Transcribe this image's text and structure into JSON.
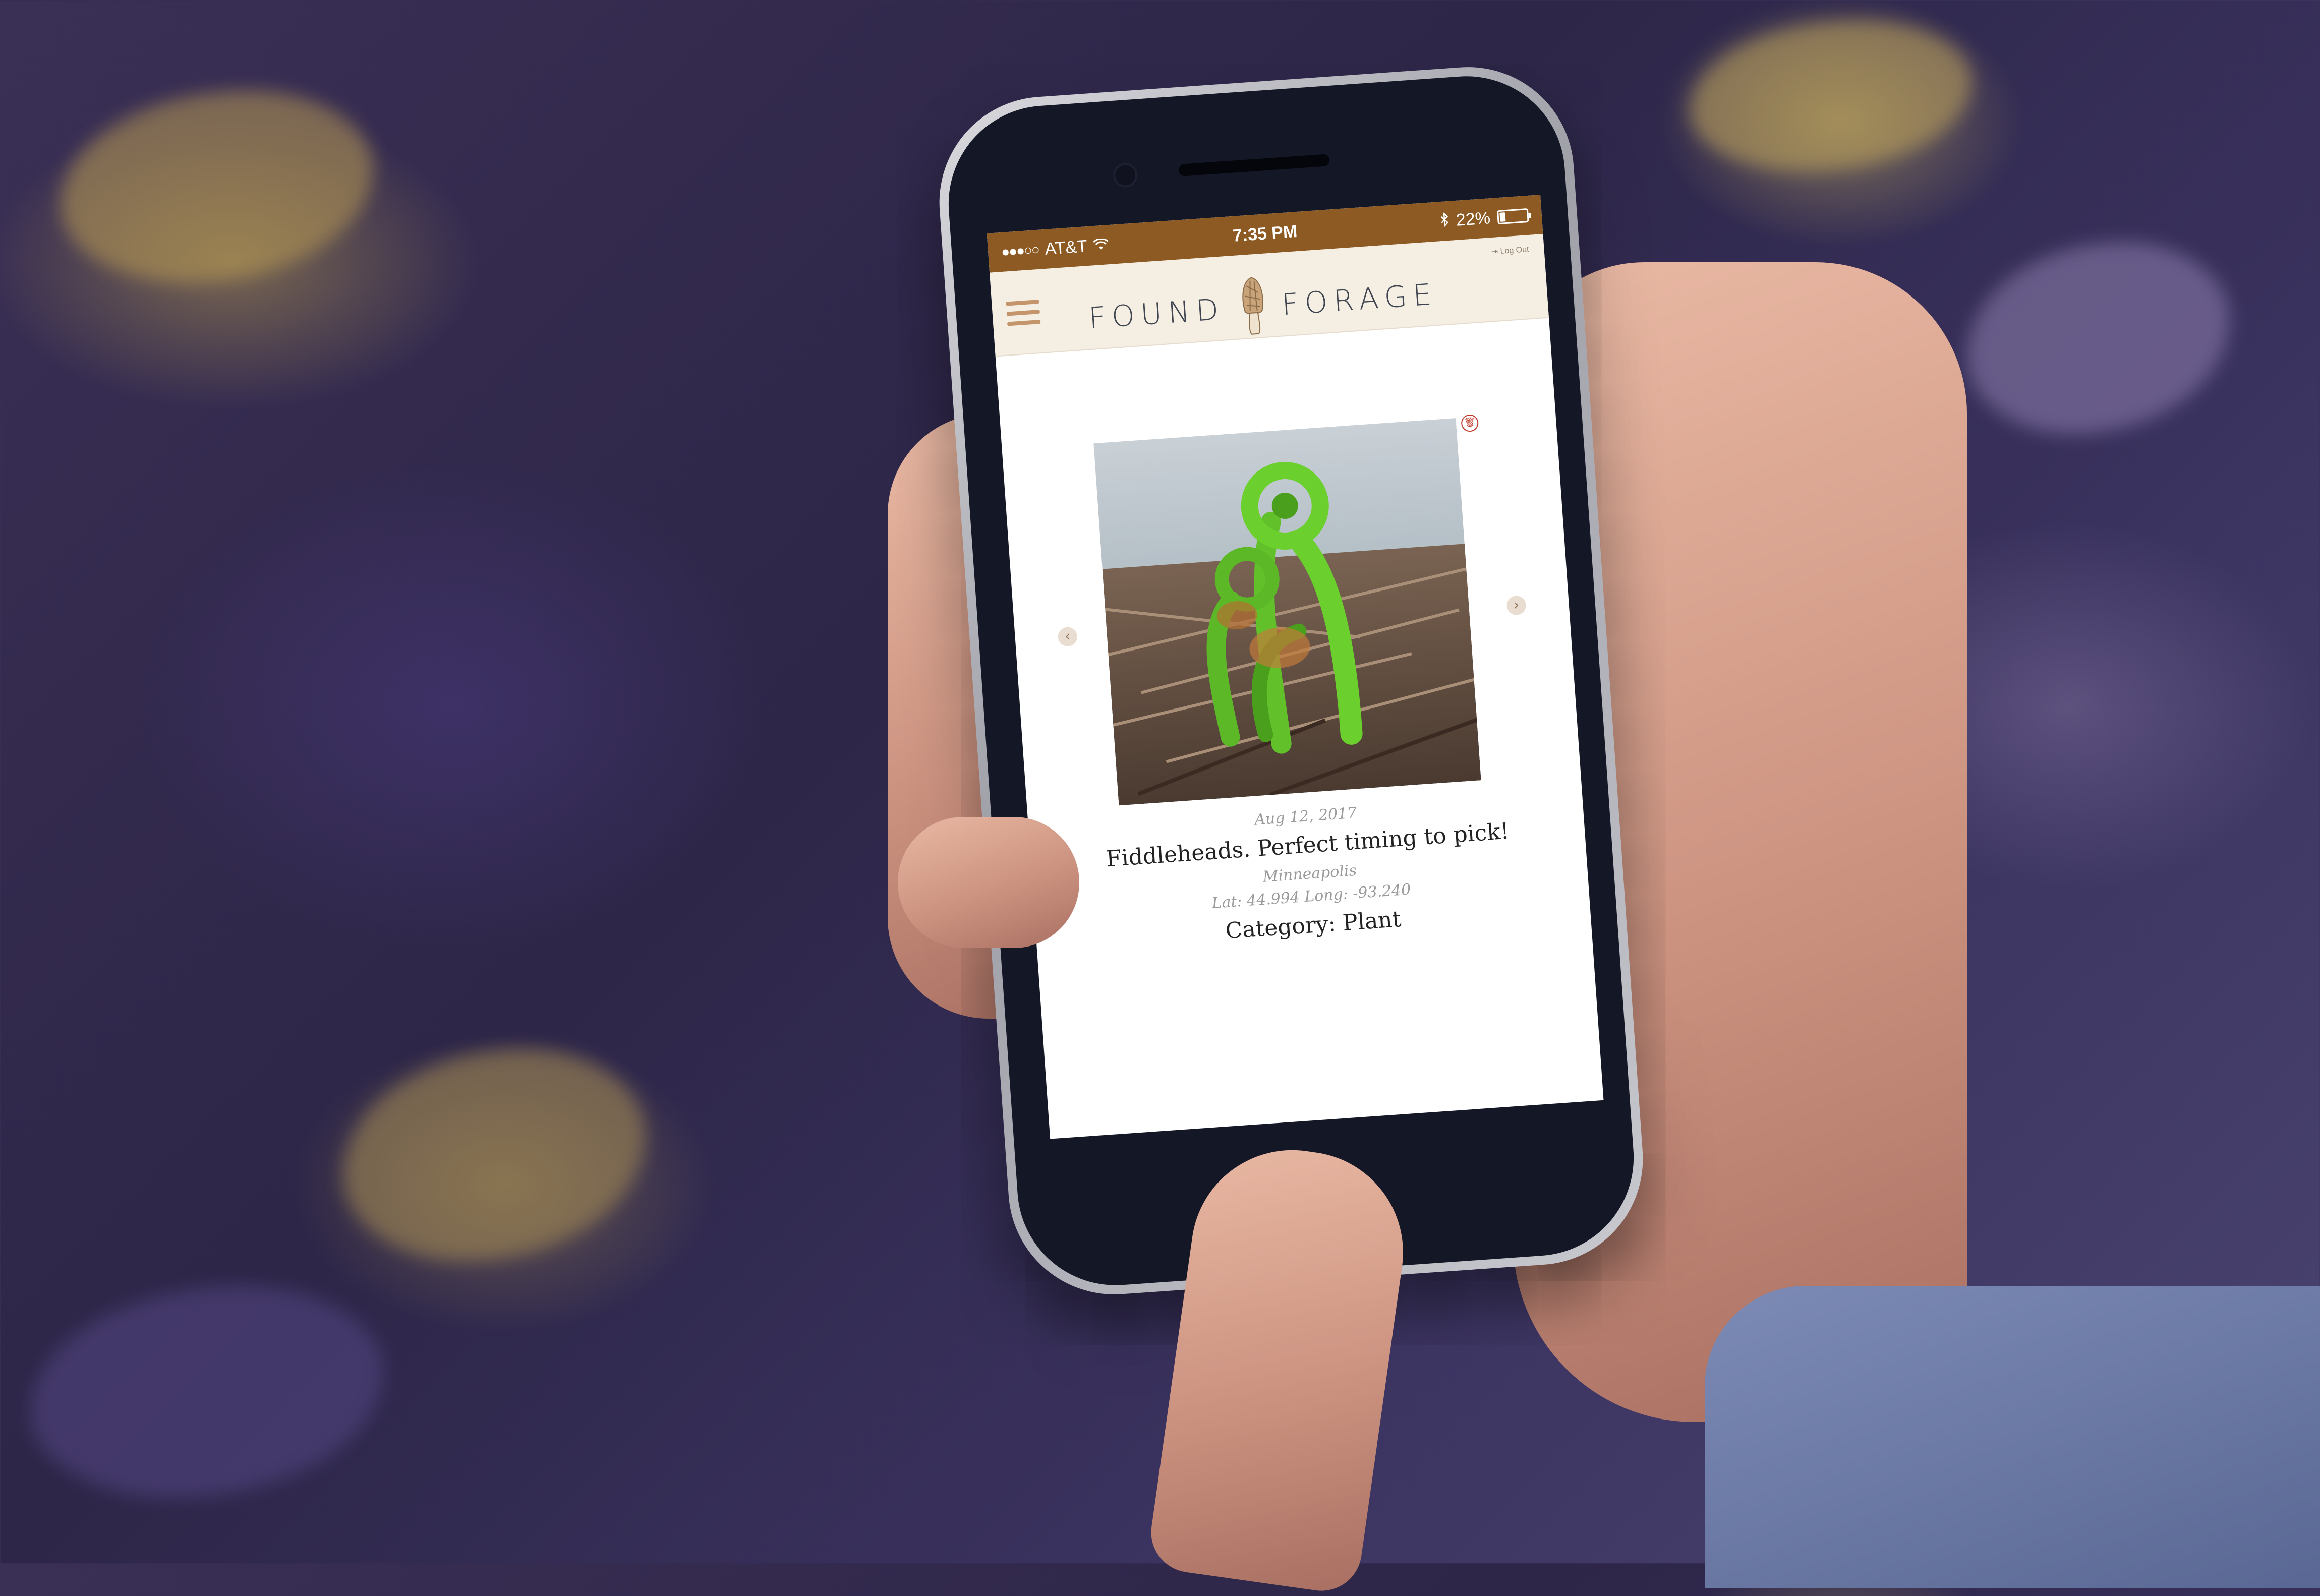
{
  "status_bar": {
    "signal": "●●●○○",
    "carrier": "AT&T",
    "time": "7:35 PM",
    "battery_percent": "22%",
    "battery_level": 0.22
  },
  "header": {
    "logo_left": "FOUND",
    "logo_right": "FORAGE",
    "logout": "Log Out",
    "logo_icon": "morel-mushroom-icon",
    "menu_icon": "hamburger-menu-icon"
  },
  "post": {
    "date": "Aug 12, 2017",
    "title": "Fiddleheads. Perfect timing to pick!",
    "location": "Minneapolis",
    "coordinates": "Lat: 44.994 Long: -93.240",
    "category": "Category: Plant"
  },
  "colors": {
    "status_bar": "#8c5a22",
    "header_bg": "#f5eee3",
    "accent": "#c4956a"
  }
}
